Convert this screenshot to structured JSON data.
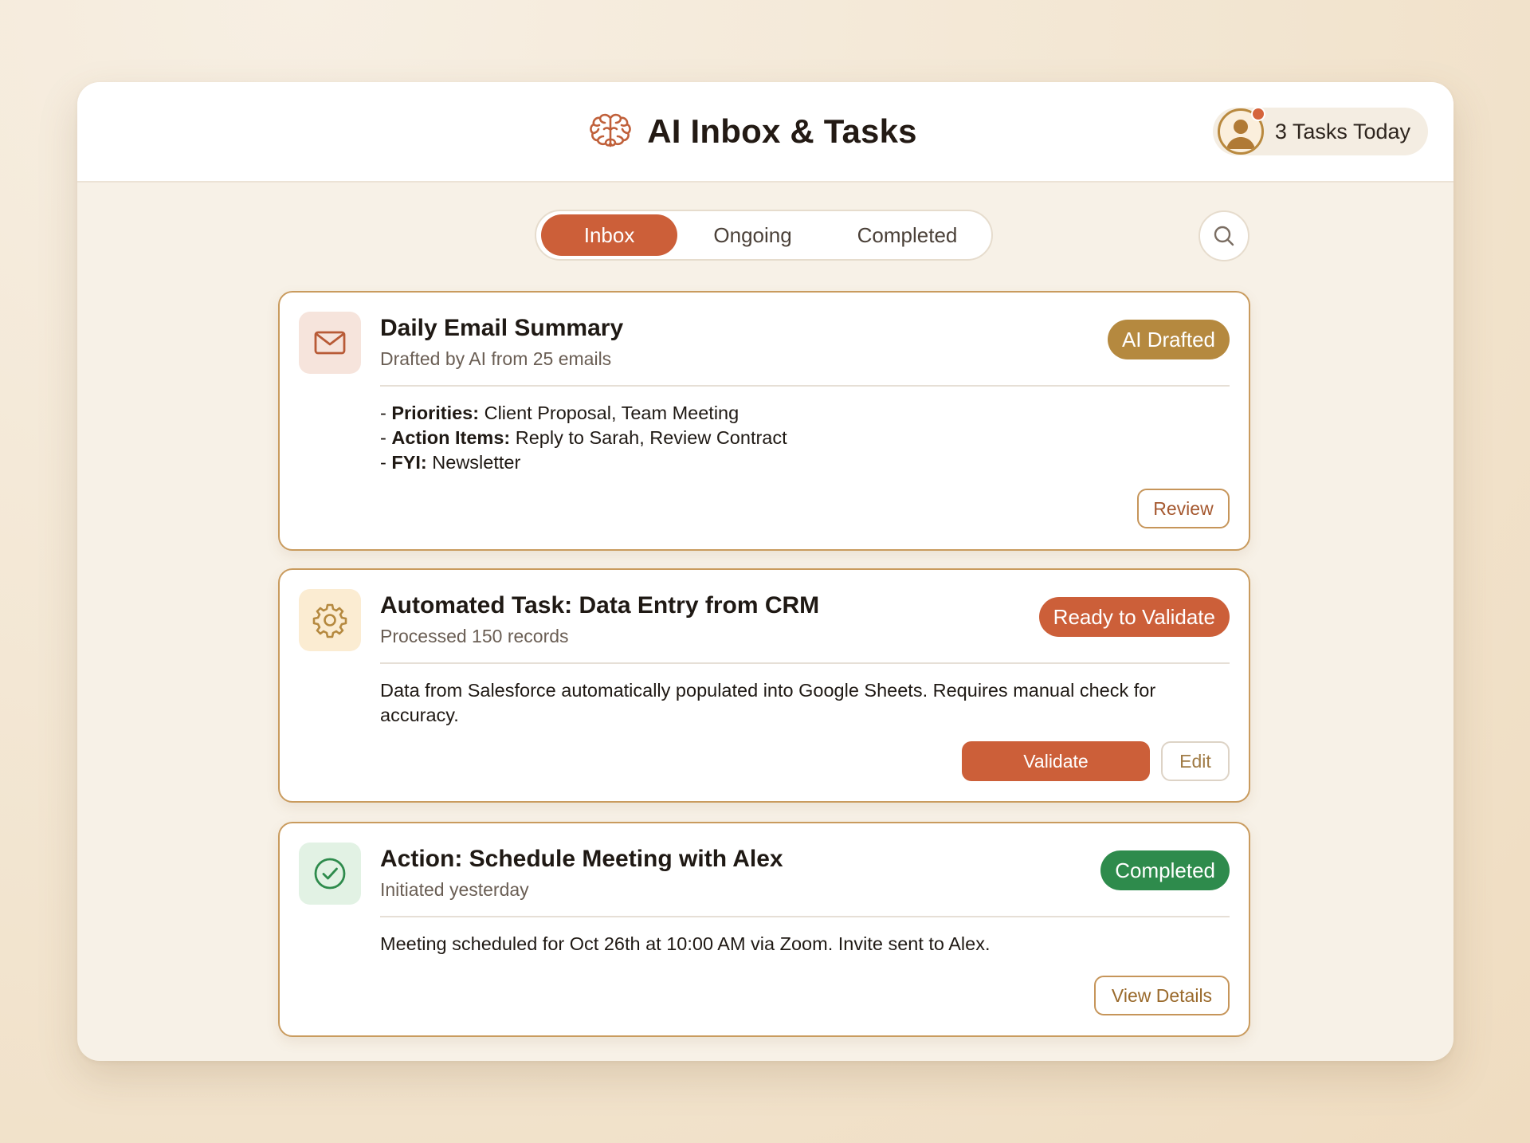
{
  "header": {
    "title": "AI Inbox & Tasks",
    "brain_icon": "brain-icon",
    "tasks_today": "3 Tasks Today"
  },
  "tabs": [
    {
      "label": "Inbox",
      "active": true
    },
    {
      "label": "Ongoing",
      "active": false
    },
    {
      "label": "Completed",
      "active": false
    }
  ],
  "colors": {
    "accent": "#cc5f39",
    "gold_badge": "#b5893f",
    "orange_badge": "#cc5f39",
    "green_badge": "#2e8b4c",
    "card_border": "#c99b5e"
  },
  "cards": [
    {
      "icon": "mail-icon",
      "title": "Daily Email Summary",
      "subtitle": "Drafted by AI from 25 emails",
      "badge": "AI Drafted",
      "lines": [
        {
          "prefix": "- ",
          "key": "Priorities:",
          "value": " Client Proposal, Team Meeting"
        },
        {
          "prefix": "- ",
          "key": "Action Items:",
          "value": " Reply to Sarah, Review Contract"
        },
        {
          "prefix": "- ",
          "key": "FYI:",
          "value": " Newsletter"
        }
      ],
      "action": "Review"
    },
    {
      "icon": "gear-icon",
      "title": "Automated Task: Data Entry from CRM",
      "subtitle": "Processed 150 records",
      "badge": "Ready to Validate",
      "body": "Data from Salesforce automatically populated into Google Sheets. Requires manual check for accuracy.",
      "primary_action": "Validate",
      "secondary_action": "Edit"
    },
    {
      "icon": "check-circle-icon",
      "title": "Action: Schedule Meeting with Alex",
      "subtitle": "Initiated yesterday",
      "badge": "Completed",
      "body": "Meeting scheduled for Oct 26th at 10:00 AM via Zoom. Invite sent to Alex.",
      "action": "View Details"
    }
  ]
}
